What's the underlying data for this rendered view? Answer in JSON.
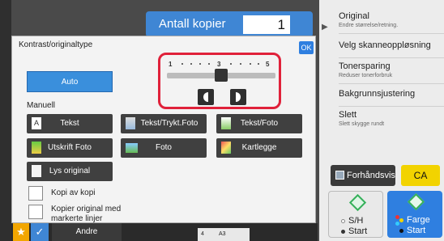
{
  "copies": {
    "label": "Antall kopier",
    "value": "1"
  },
  "right_panel": {
    "original": {
      "title": "Original",
      "sub": "Endre størrelse/retning."
    },
    "scan_resolution": "Velg skanneoppløsning",
    "toner_saving": {
      "title": "Tonersparing",
      "sub": "Reduser tonerforbruk"
    },
    "background": "Bakgrunnsjustering",
    "erase": {
      "title": "Slett",
      "sub": "Slett skygge rundt"
    }
  },
  "preview_label": "Forhåndsvis",
  "ca_label": "CA",
  "start_bw": {
    "line1": "S/H",
    "line2": "Start"
  },
  "start_color": {
    "line1": "Farge",
    "line2": "Start"
  },
  "dialog": {
    "title": "Kontrast/originaltype",
    "ok": "OK",
    "scale": {
      "low": "1",
      "mid": "3",
      "high": "5",
      "current": 3
    },
    "auto": "Auto",
    "manual": "Manuell",
    "options": {
      "text": "Tekst",
      "text_printed_photo": "Tekst/Trykt.Foto",
      "text_photo": "Tekst/Foto",
      "print_photo": "Utskrift Foto",
      "photo": "Foto",
      "map": "Kartlegge",
      "light_original": "Lys original"
    },
    "copy_of_copy": "Kopi av kopi",
    "copy_marked": [
      "Kopier original med",
      "markerte linjer"
    ]
  },
  "bottom": {
    "others": "Andre",
    "star": "★",
    "check": "✓",
    "tray_num": "4",
    "tray_size": "A3"
  },
  "colors": {
    "accent": "#3a8fdc",
    "highlight": "#e0213a",
    "ca": "#f2d300",
    "favorite": "#f2a600"
  },
  "icons": {
    "original_arrow": "chevron-right-icon",
    "preview": "preview-icon",
    "start": "diamond-start-icon",
    "contrast_dec": "contrast-decrease-icon",
    "contrast_inc": "contrast-increase-icon"
  }
}
